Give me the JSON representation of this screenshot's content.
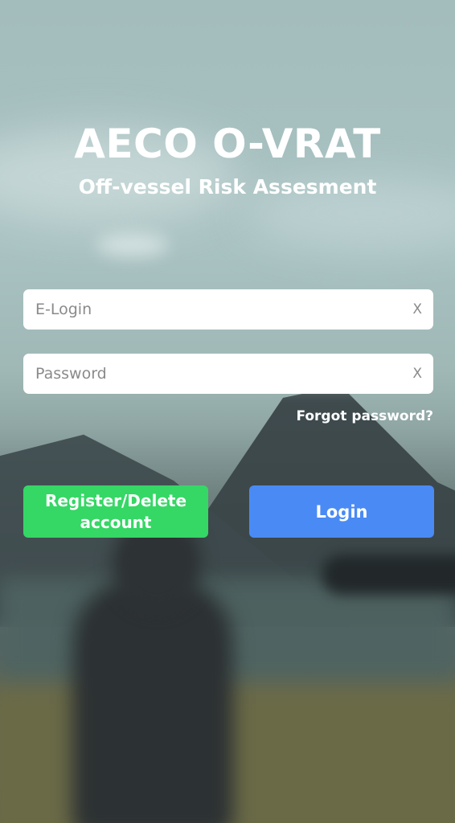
{
  "header": {
    "title": "AECO O-VRAT",
    "subtitle": "Off-vessel Risk Assesment"
  },
  "form": {
    "login": {
      "placeholder": "E-Login",
      "value": "",
      "clear_label": "X"
    },
    "password": {
      "placeholder": "Password",
      "value": "",
      "clear_label": "X"
    },
    "forgot_label": "Forgot password?"
  },
  "actions": {
    "register_label": "Register/Delete account",
    "login_label": "Login"
  },
  "colors": {
    "register_button": "#35d765",
    "login_button": "#4a8af4",
    "text_on_background": "#ffffff"
  }
}
